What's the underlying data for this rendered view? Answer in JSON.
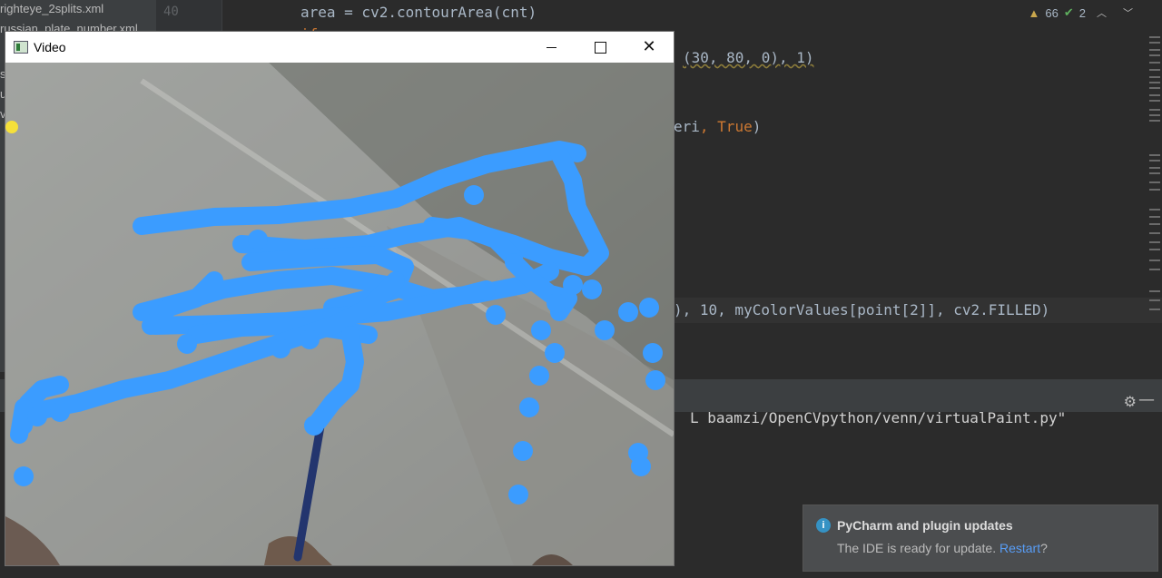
{
  "project_panel": {
    "files": [
      "righteye_2splits.xml",
      "russian_plate_number.xml",
      "s",
      "u",
      "v"
    ]
  },
  "gutter": {
    "line_numbers": [
      "40"
    ]
  },
  "editor": {
    "line1": "area = cv2.contourArea(cnt)",
    "line2_fragment": "(30, 80, 0), 1)",
    "line3_fragment": "eri",
    "line3_true": "True",
    "line3_close": ")",
    "line4_fragment": "), 10, myColorValues[point[2]], cv2.FILLED)"
  },
  "inspection": {
    "warnings": "66",
    "checks": "2"
  },
  "run": {
    "output_fragment": "L baamzi/OpenCVpython/venn/virtualPaint.py\""
  },
  "notification": {
    "title": "PyCharm and plugin updates",
    "body_prefix": "The IDE is ready for update.",
    "link": "Restart",
    "body_suffix": "?"
  },
  "video_window": {
    "title": "Video",
    "minimize_icon": "minimize-icon",
    "maximize_icon": "maximize-icon",
    "close_icon": "close-icon",
    "paint_color": "#3b9cff"
  },
  "colors": {
    "ide_bg": "#2b2b2b",
    "accent_blue": "#589df6",
    "paint_blue": "#3b9cff",
    "warning_yellow": "#c9a74d"
  }
}
